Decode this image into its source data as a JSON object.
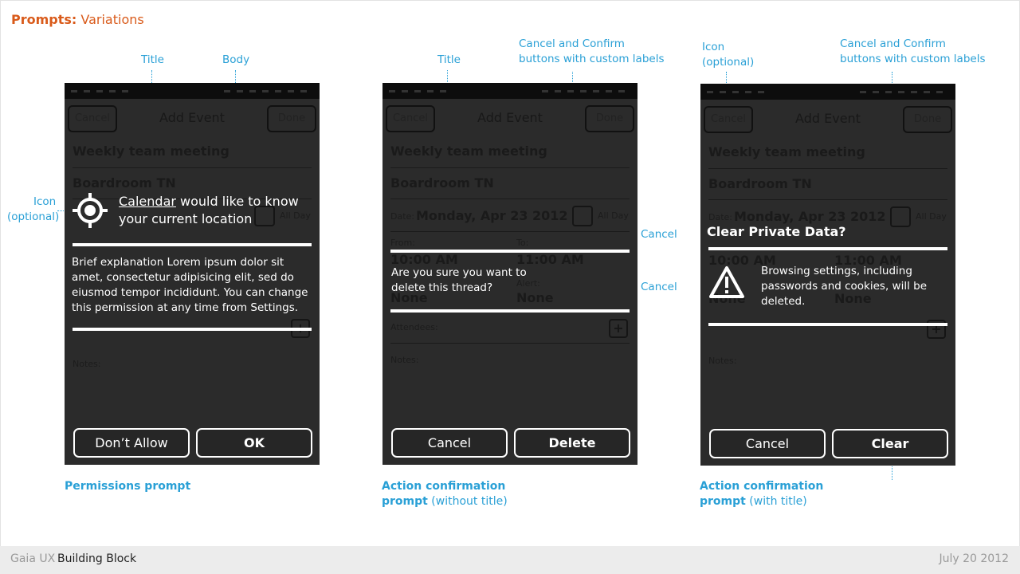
{
  "slide": {
    "title_bold": "Prompts:",
    "title_rest": " Variations"
  },
  "annotations": {
    "title_1": "Title",
    "body": "Body",
    "icon_optional_left_1": "Icon",
    "icon_optional_left_2": "(optional)",
    "title_2": "Title",
    "custom_labels_1a": "Cancel and Confirm",
    "custom_labels_1b": "buttons with custom labels",
    "cancel_a": "Cancel",
    "cancel_b": "Cancel",
    "icon_optional_right_1": "Icon",
    "icon_optional_right_2": "(optional)",
    "custom_labels_2a": "Cancel and Confirm",
    "custom_labels_2b": "buttons with custom labels"
  },
  "captions": {
    "permissions": "Permissions prompt",
    "action_without_1": "Action confirmation",
    "action_without_2": "prompt",
    "action_without_3": " (without title)",
    "action_with_1": "Action confirmation",
    "action_with_2": "prompt",
    "action_with_3": " (with title)"
  },
  "form": {
    "cancel": "Cancel",
    "title": "Add Event",
    "done": "Done",
    "event_name": "Weekly team meeting",
    "location": "Boardroom TN",
    "date_label": "Date:",
    "date_value": "Monday, Apr 23 2012",
    "allday": "All Day",
    "from_label": "From:",
    "to_label": "To:",
    "from_value": "10:00 AM",
    "to_value": "11:00 AM",
    "repeat_value": "None",
    "alert_label": "Alert:",
    "alert_value": "None",
    "attendees": "Attendees:",
    "notes": "Notes:",
    "plus": "+"
  },
  "prompts": {
    "permissions": {
      "app_name": "Calendar",
      "title_rest_1": " would like to know",
      "title_rest_2": "your current location",
      "body": "Brief explanation Lorem ipsum dolor sit amet, consectetur adipisicing elit, sed do eiusmod tempor incididunt. You can change this permission at any time from Settings.",
      "deny": "Don’t Allow",
      "ok": "OK",
      "icon": "location-target-icon"
    },
    "action_no_title": {
      "message": "Are you sure you want to delete this thread?",
      "cancel": "Cancel",
      "confirm": "Delete"
    },
    "action_with_title": {
      "title": "Clear Private Data?",
      "message": "Browsing settings, including passwords and cookies, will be deleted.",
      "cancel": "Cancel",
      "confirm": "Clear",
      "icon": "warning-icon"
    }
  },
  "footer": {
    "brand": "Gaia UX",
    "block": "Building Block",
    "date": "July 20 2012"
  },
  "colors": {
    "accent": "#2aa0d6",
    "title_orange": "#d95b1b",
    "phone_bg": "#2b2b2b"
  }
}
